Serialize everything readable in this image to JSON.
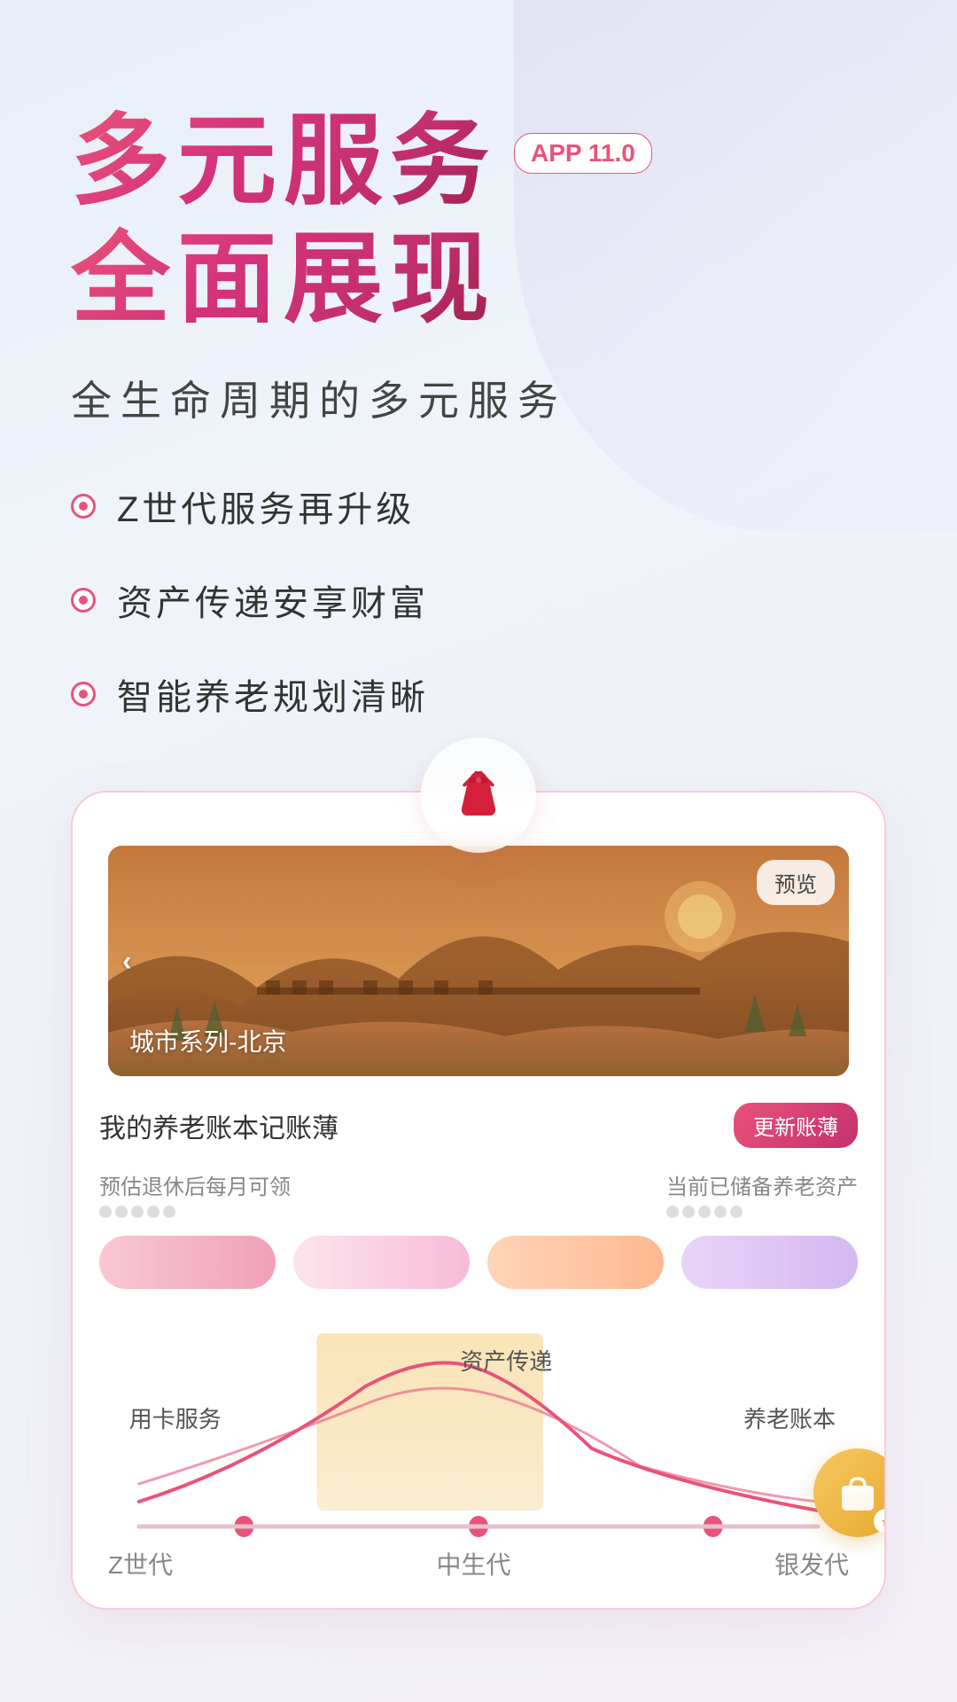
{
  "background": {
    "gradient_start": "#e8eef8",
    "gradient_end": "#f5f0f8"
  },
  "hero": {
    "title_line1": "多元服务",
    "title_line2": "全面展现",
    "app_badge": "APP 11.0",
    "subtitle": "全生命周期的多元服务"
  },
  "features": [
    {
      "id": 1,
      "label": "Z世代服务再升级"
    },
    {
      "id": 2,
      "label": "资产传递安享财富"
    },
    {
      "id": 3,
      "label": "智能养老规划清晰"
    }
  ],
  "card": {
    "banner_label": "城市系列-北京",
    "preview_btn": "预览",
    "ledger_title": "我的养老账本记账薄",
    "update_btn": "更新账薄",
    "col1_label": "预估退休后每月可领",
    "col2_label": "当前已储备养老资产",
    "stars1": [
      "★",
      "★",
      "★",
      "★",
      "★"
    ],
    "stars2": [
      "★",
      "★",
      "★",
      "★",
      "★"
    ]
  },
  "lifecycle": {
    "label_card_service": "用卡服务",
    "label_asset_transfer": "资产传递",
    "label_pension_book": "养老账本",
    "axis_labels": [
      "Z世代",
      "中生代",
      "银发代"
    ]
  }
}
